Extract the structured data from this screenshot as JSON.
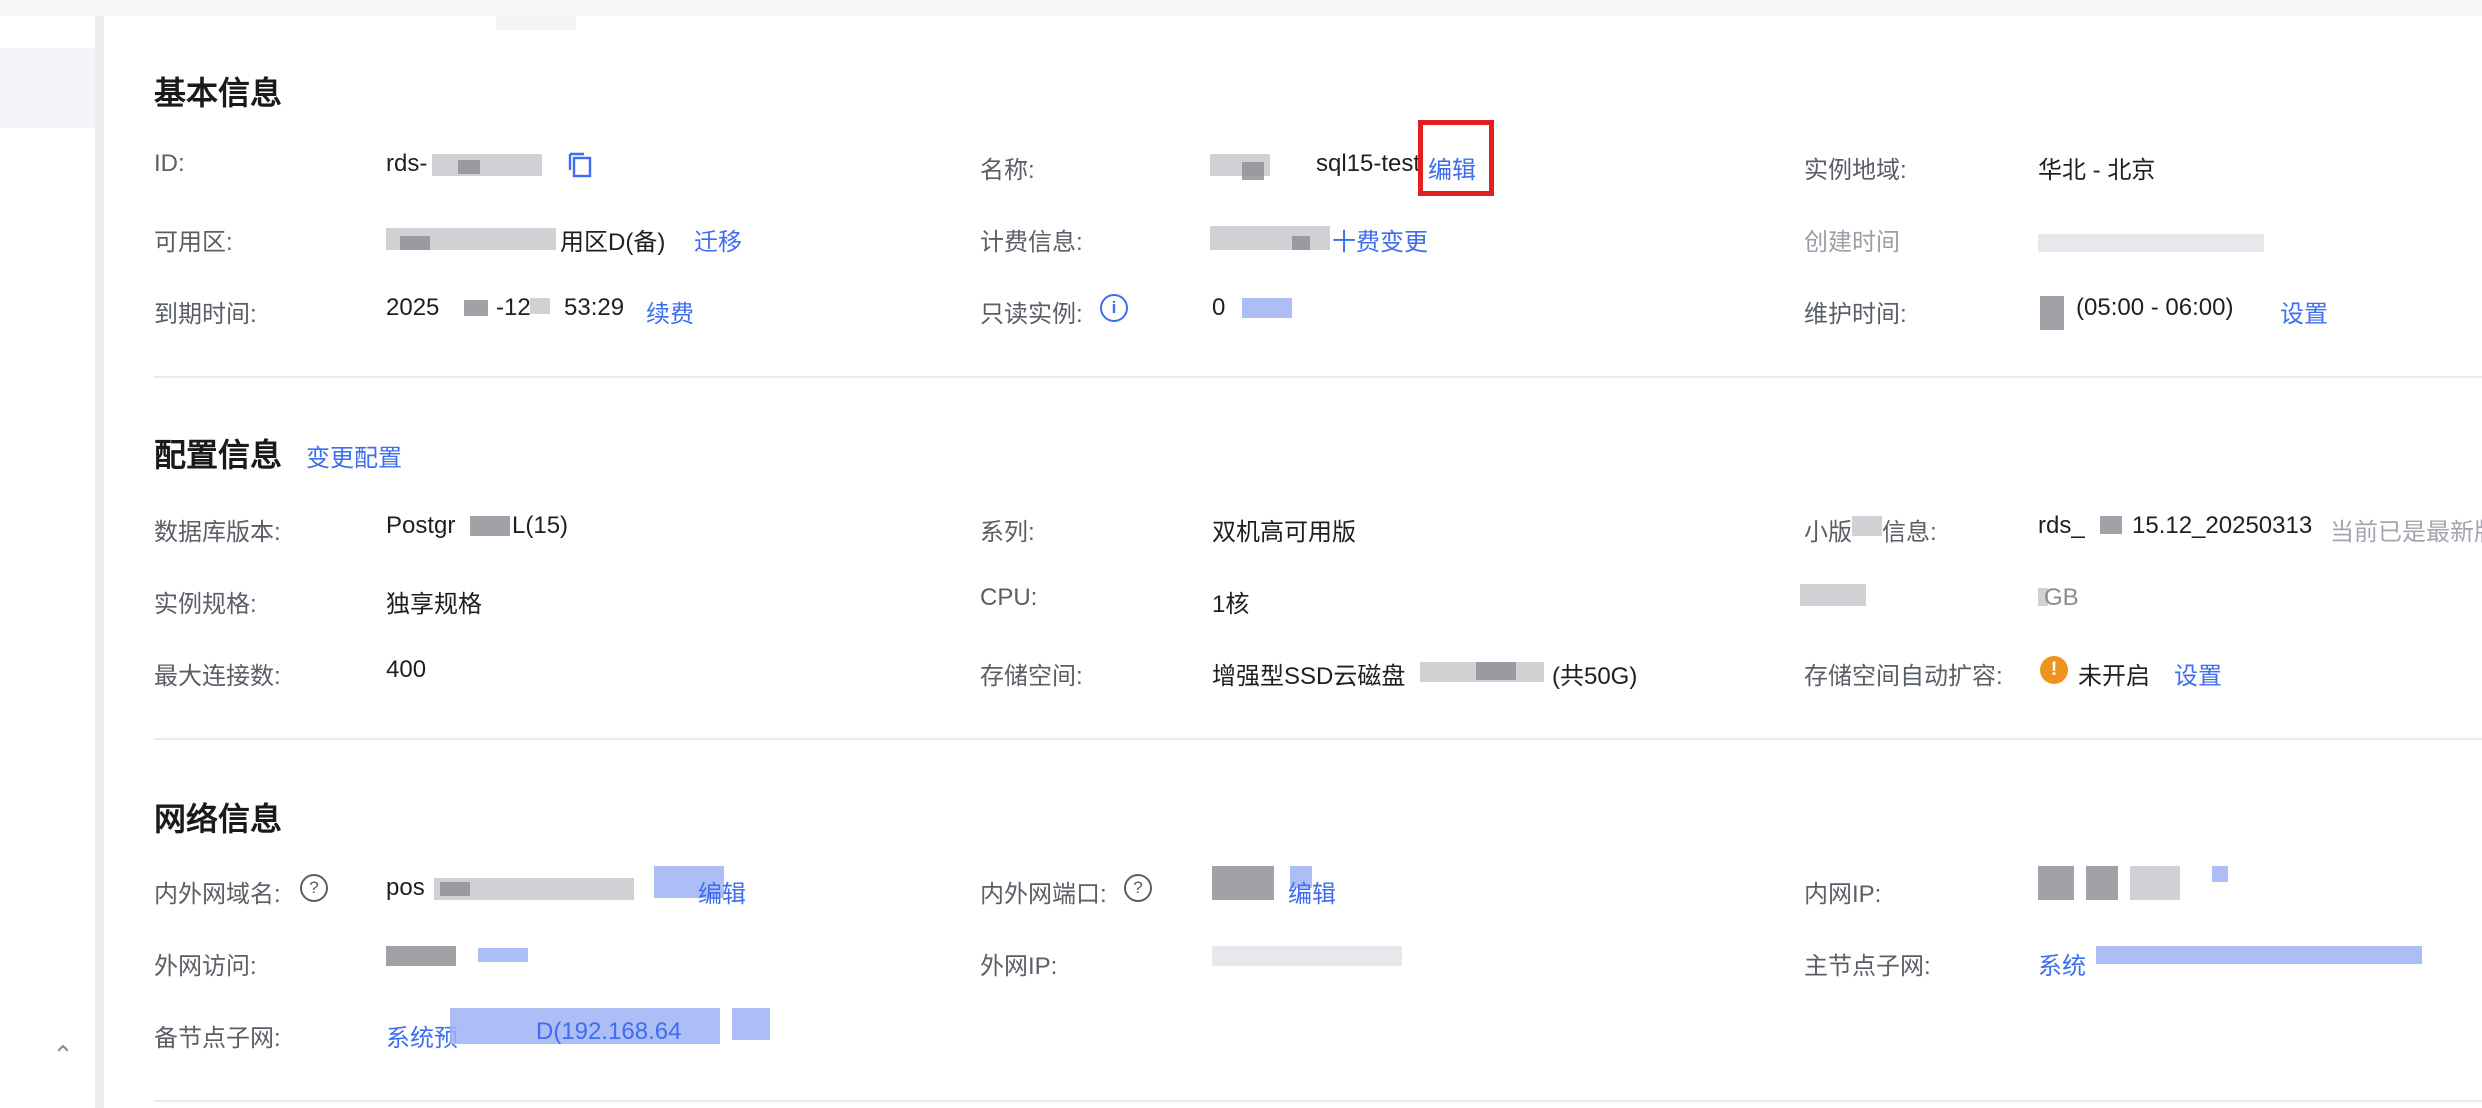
{
  "basic": {
    "title": "基本信息",
    "id_label": "ID:",
    "id_value": "rds-",
    "name_label": "名称:",
    "name_value": "sql15-test",
    "name_edit": "编辑",
    "region_label": "实例地域:",
    "region_value": "华北 - 北京",
    "zone_label": "可用区:",
    "zone_value": "用区D(备)",
    "zone_migrate": "迁移",
    "billing_label": "计费信息:",
    "billing_change": "十费变更",
    "created_label": "创建时间",
    "expire_label": "到期时间:",
    "expire_part1": "2025",
    "expire_part2": "-12",
    "expire_part3": "53:29",
    "renew": "续费",
    "readonly_label": "只读实例:",
    "readonly_value": "0",
    "maint_label": "维护时间:",
    "maint_value": "(05:00 - 06:00)",
    "maint_set": "设置"
  },
  "config": {
    "title": "配置信息",
    "change_link": "变更配置",
    "dbver_label": "数据库版本:",
    "dbver_value": "Postgr",
    "dbver_suffix": "L(15)",
    "series_label": "系列:",
    "series_value": "双机高可用版",
    "minor_label_a": "小版",
    "minor_label_b": "信息:",
    "minor_value_a": "rds_",
    "minor_value_b": "15.12_20250313",
    "minor_note": "当前已是最新版",
    "spec_label": "实例规格:",
    "spec_value": "独享规格",
    "cpu_label": "CPU:",
    "cpu_value": "1核",
    "mem_value": "GB",
    "maxconn_label": "最大连接数:",
    "maxconn_value": "400",
    "storage_label": "存储空间:",
    "storage_value": "增强型SSD云磁盘",
    "storage_total": "(共50G)",
    "autoscale_label": "存储空间自动扩容:",
    "autoscale_value": "未开启",
    "autoscale_set": "设置"
  },
  "network": {
    "title": "网络信息",
    "domain_label": "内外网域名:",
    "domain_value": "pos",
    "domain_edit": "编辑",
    "port_label": "内外网端口:",
    "port_edit": "编辑",
    "ip_label": "内网IP:",
    "wan_label": "外网访问:",
    "wanip_label": "外网IP:",
    "master_subnet_label": "主节点子网:",
    "master_subnet_value": "系统",
    "slave_subnet_label": "备节点子网:",
    "slave_subnet_value": "系统预",
    "slave_subnet_ip": "D(192.168.64"
  },
  "icons": {
    "copy": "copy-icon",
    "info": "info-icon",
    "help": "help-icon",
    "warning": "warning-icon",
    "collapse": "chevron-up-icon"
  },
  "colors": {
    "link": "#3d6df0",
    "label": "#5a5e66",
    "warning": "#f0921f",
    "highlight": "#e02020"
  }
}
